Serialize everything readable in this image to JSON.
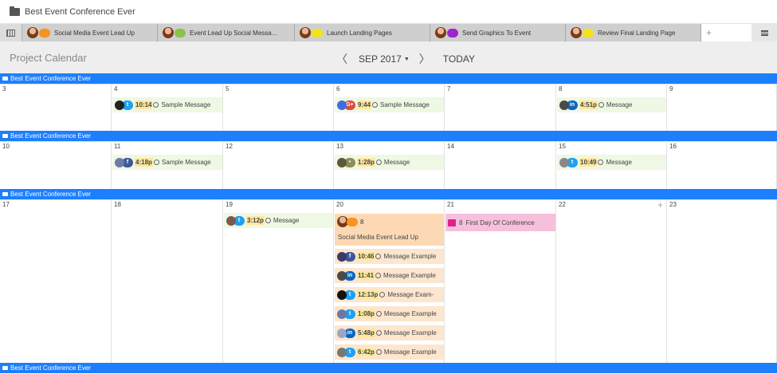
{
  "topbar": {
    "title": "Best Event Conference Ever"
  },
  "tabs": [
    {
      "label": "Social Media Event Lead Up",
      "badge_color": "#f7931e",
      "width": 170
    },
    {
      "label": "Event Lead Up Social Messa...",
      "badge_color": "#8bc34a",
      "width": 172
    },
    {
      "label": "Launch Landing Pages",
      "badge_color": "#f5e21a",
      "width": 170
    },
    {
      "label": "Send Graphics To Event",
      "badge_color": "#9c27d0",
      "width": 170
    },
    {
      "label": "Review Final Landing Page",
      "badge_color": "#f5e21a",
      "width": 170
    }
  ],
  "tab_plus": "+",
  "calendar": {
    "title": "Project Calendar",
    "prev": "〈",
    "month": "SEP 2017",
    "caret": "▼",
    "next": "〉",
    "today": "TODAY"
  },
  "week_label": "Best Event Conference Ever",
  "weeks": [
    {
      "days": [
        "3",
        "4",
        "5",
        "6",
        "7",
        "8",
        "9"
      ]
    },
    {
      "days": [
        "10",
        "11",
        "12",
        "13",
        "14",
        "15",
        "16"
      ]
    },
    {
      "days": [
        "17",
        "18",
        "19",
        "20",
        "21",
        "22",
        "23"
      ]
    }
  ],
  "events": [
    {
      "week": 0,
      "col": 1,
      "slot": 0,
      "time": "10:14",
      "text": "Sample Message",
      "dot": "#222",
      "soc": "#1da1f2",
      "soc_glyph": "t"
    },
    {
      "week": 0,
      "col": 3,
      "slot": 0,
      "time": "9:44",
      "text": "Sample Message",
      "dot": "#3b6fe0",
      "soc": "#dd4b39",
      "soc_glyph": "G+"
    },
    {
      "week": 0,
      "col": 5,
      "slot": 0,
      "time": "4:51p",
      "text": "Message",
      "dot": "#4a4a4a",
      "soc": "#0a66c2",
      "soc_glyph": "in"
    },
    {
      "week": 1,
      "col": 1,
      "slot": 0,
      "time": "4:18p",
      "text": "Sample Message",
      "dot": "#6b7aa8",
      "soc": "#3b5998",
      "soc_glyph": "f"
    },
    {
      "week": 1,
      "col": 3,
      "slot": 0,
      "time": "1:28p",
      "text": "Message",
      "dot": "#5a5a3a",
      "soc": "#8d8d5a",
      "soc_glyph": "•"
    },
    {
      "week": 1,
      "col": 5,
      "slot": 0,
      "time": "10:49",
      "text": "Message",
      "dot": "#888",
      "soc": "#1da1f2",
      "soc_glyph": "t"
    },
    {
      "week": 2,
      "col": 2,
      "slot": 0,
      "time": "3:12p",
      "text": "Message",
      "dot": "#7a5a4a",
      "soc": "#1da1f2",
      "soc_glyph": "t"
    },
    {
      "week": 2,
      "col": 3,
      "slot": 1,
      "time": "10:46",
      "text": "Message Example",
      "dot": "#3a3a6a",
      "soc": "#3b5998",
      "soc_glyph": "f",
      "orange": true
    },
    {
      "week": 2,
      "col": 3,
      "slot": 2,
      "time": "11:41",
      "text": "Message Example",
      "dot": "#4a4a4a",
      "soc": "#0a66c2",
      "soc_glyph": "in",
      "orange": true
    },
    {
      "week": 2,
      "col": 3,
      "slot": 3,
      "time": "12:13p",
      "text": "Message Exam-",
      "dot": "#111",
      "soc": "#1da1f2",
      "soc_glyph": "t",
      "orange": true
    },
    {
      "week": 2,
      "col": 3,
      "slot": 4,
      "time": "1:08p",
      "text": "Message Example",
      "dot": "#6a7aa0",
      "soc": "#1da1f2",
      "soc_glyph": "t",
      "orange": true
    },
    {
      "week": 2,
      "col": 3,
      "slot": 5,
      "time": "5:48p",
      "text": "Message Example",
      "dot": "#9aa8c8",
      "soc": "#0a66c2",
      "soc_glyph": "in",
      "orange": true
    },
    {
      "week": 2,
      "col": 3,
      "slot": 6,
      "time": "6:42p",
      "text": "Message Example",
      "dot": "#777",
      "soc": "#1da1f2",
      "soc_glyph": "t",
      "orange": true
    }
  ],
  "big_event": {
    "count": "8",
    "label": "Social Media Event Lead Up"
  },
  "conference_event": {
    "count": "8",
    "label": "First Day Of Conference"
  },
  "add_day": "+"
}
